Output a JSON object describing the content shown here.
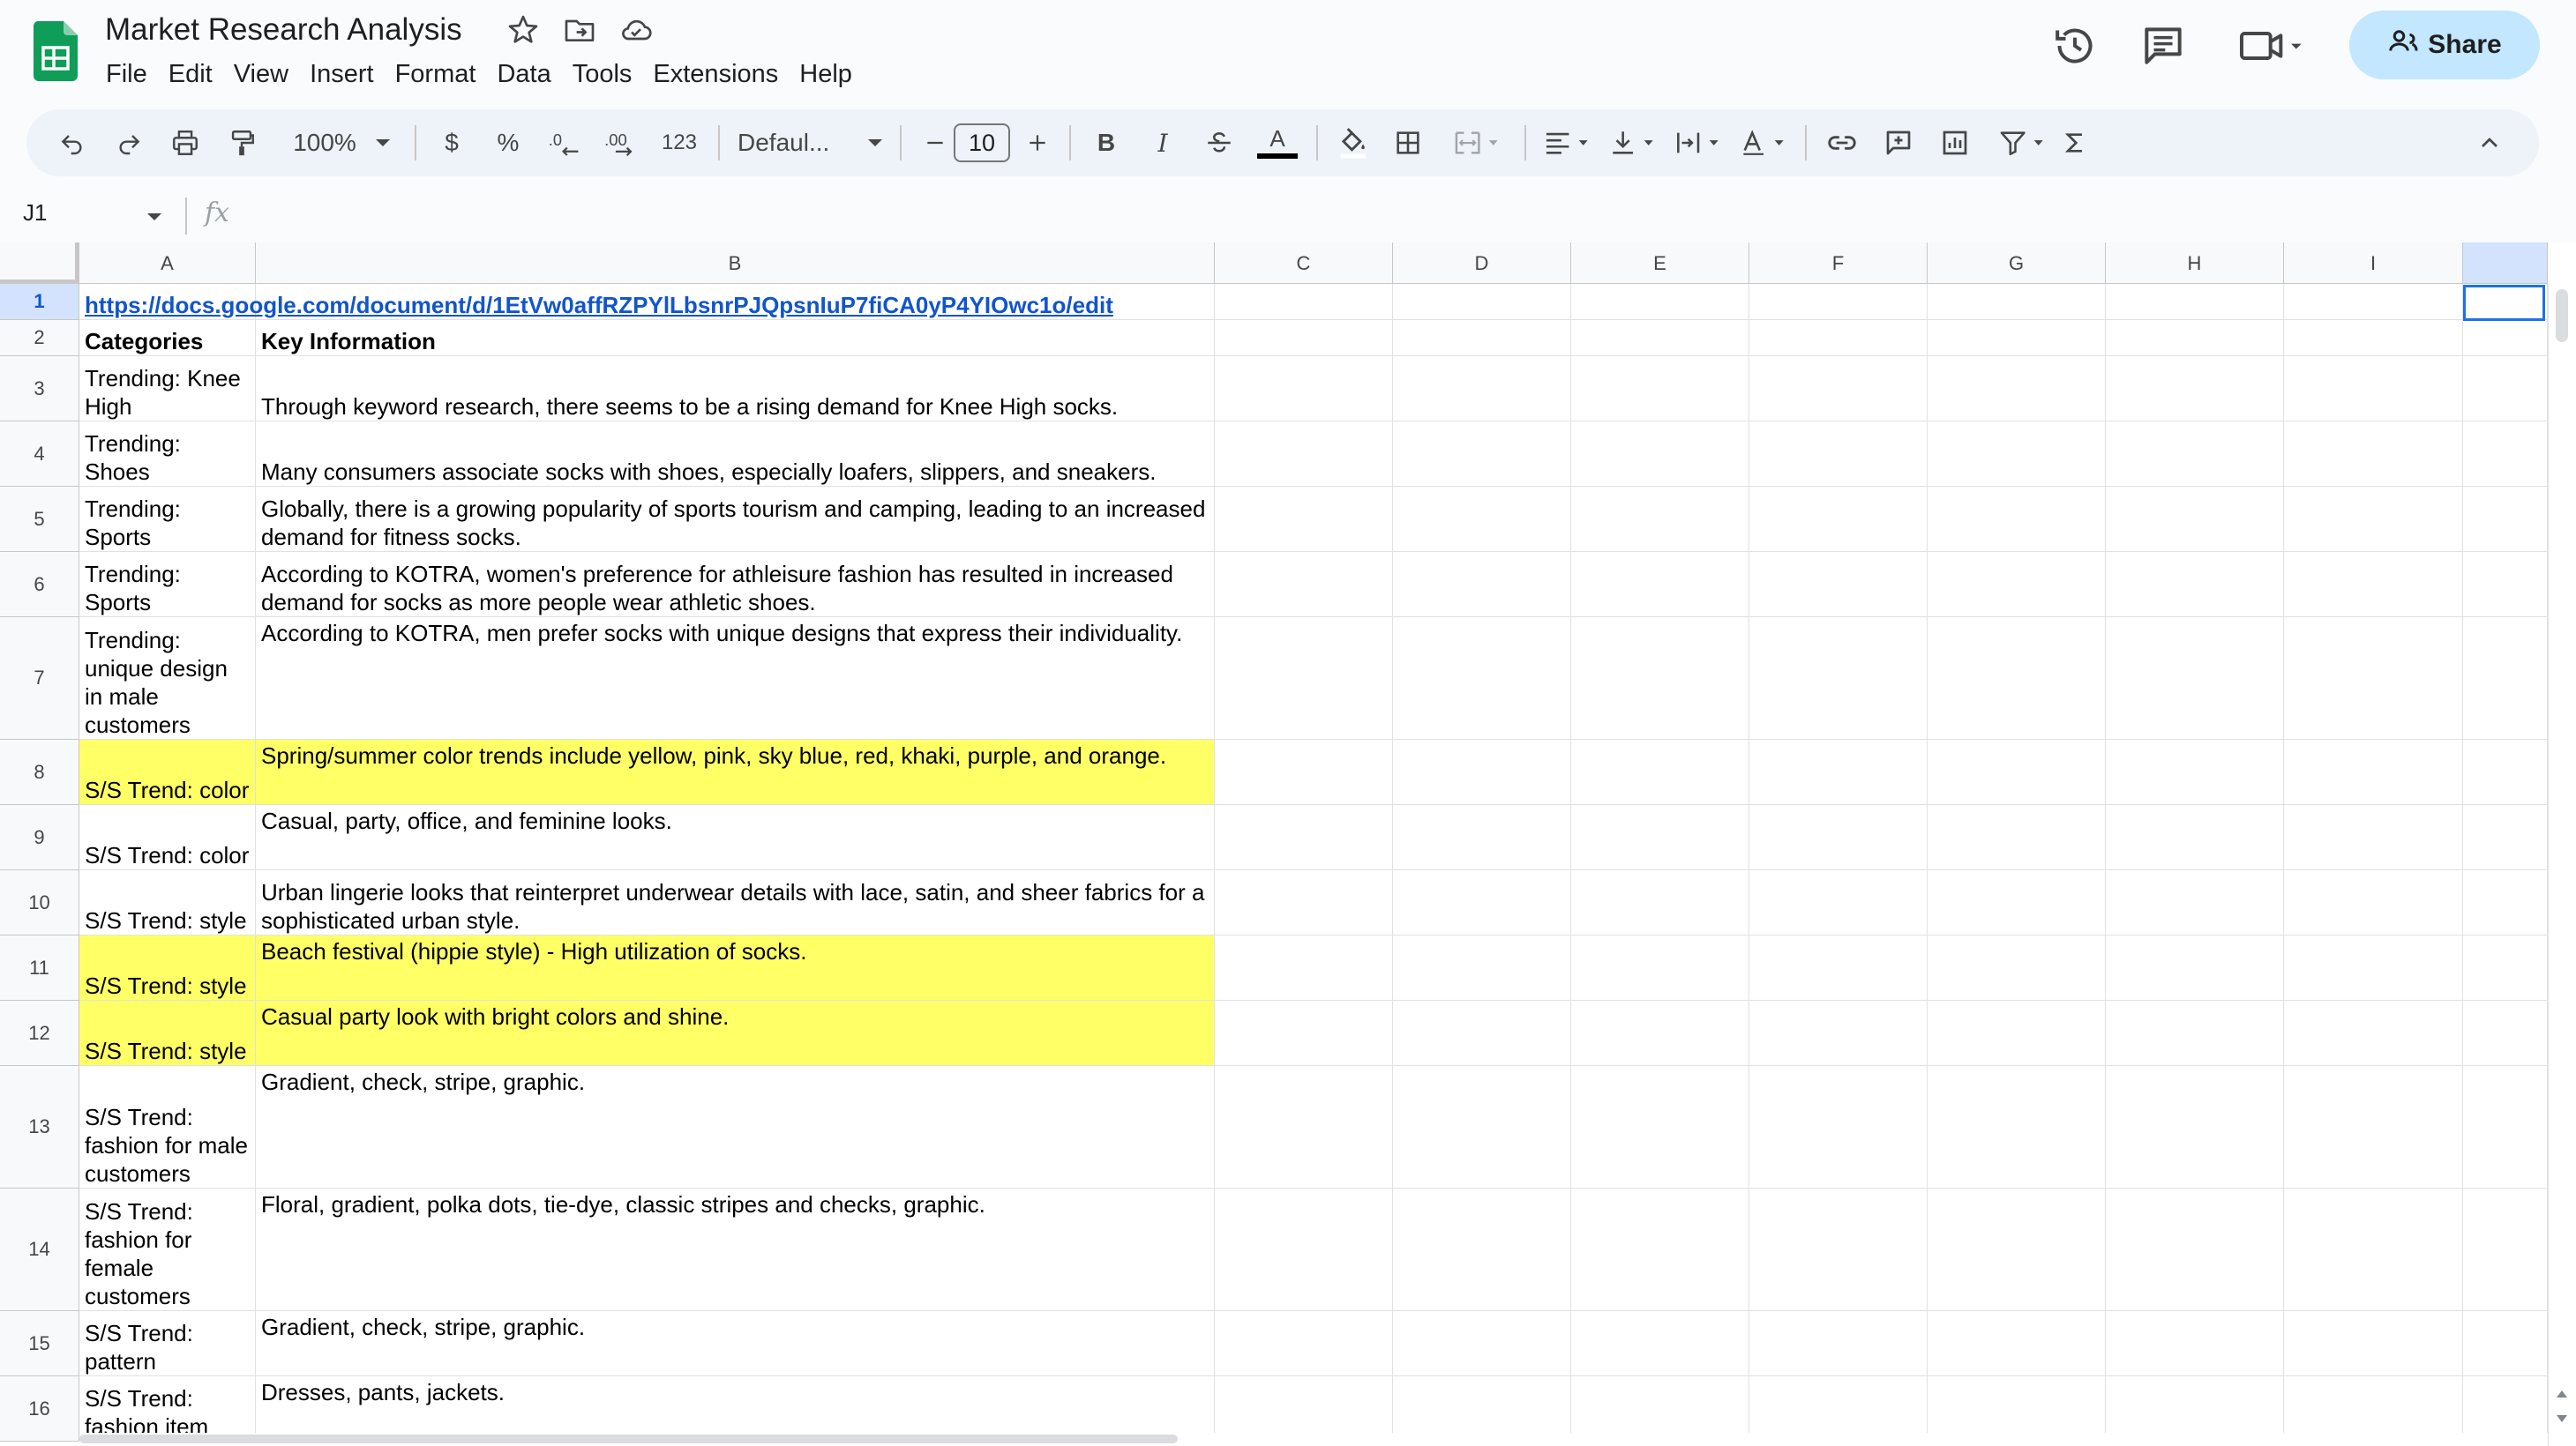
{
  "app": {
    "title": "Market Research Analysis",
    "menu": [
      "File",
      "Edit",
      "View",
      "Insert",
      "Format",
      "Data",
      "Tools",
      "Extensions",
      "Help"
    ],
    "share_label": "Share",
    "accent": "#c2e7ff"
  },
  "toolbar": {
    "zoom": "100%",
    "currency": "$",
    "percent": "%",
    "number_format": "123",
    "font": "Defaul...",
    "font_size": "10",
    "bold": "B",
    "italic": "I",
    "text_color": "A"
  },
  "formula_bar": {
    "cell_ref": "J1",
    "fx": "fx"
  },
  "sheet": {
    "columns": [
      "A",
      "B",
      "C",
      "D",
      "E",
      "F",
      "G",
      "H",
      "I"
    ],
    "highlight_color": "#ffff66",
    "rows": [
      {
        "n": "1",
        "a": "",
        "b": "",
        "link": "https://docs.google.com/document/d/1EtVw0affRZPYlLbsnrPJQpsnIuP7fiCA0yP4YIOwc1o/edit"
      },
      {
        "n": "2",
        "a": "Categories",
        "b": "Key Information"
      },
      {
        "n": "3",
        "a": "Trending: Knee High",
        "b": "Through keyword research, there seems to be a rising demand for Knee High socks."
      },
      {
        "n": "4",
        "a": "Trending: Shoes",
        "b": "Many consumers associate socks with shoes, especially loafers, slippers, and sneakers."
      },
      {
        "n": "5",
        "a": "Trending: Sports",
        "b": "Globally, there is a growing popularity of sports tourism and camping, leading to an increased demand for fitness socks."
      },
      {
        "n": "6",
        "a": "Trending: Sports",
        "b": "According to KOTRA, women's preference for athleisure fashion has resulted in increased demand for socks as more people wear athletic shoes."
      },
      {
        "n": "7",
        "a": "Trending: unique design in male customers",
        "b": "According to KOTRA, men prefer socks with unique designs that express their individuality."
      },
      {
        "n": "8",
        "a": "S/S Trend: color",
        "b": "Spring/summer color trends include yellow, pink, sky blue, red, khaki, purple, and orange."
      },
      {
        "n": "9",
        "a": "S/S Trend: color",
        "b": "Casual, party, office, and feminine looks."
      },
      {
        "n": "10",
        "a": "S/S Trend: style",
        "b": "Urban lingerie looks that reinterpret underwear details with lace, satin, and sheer fabrics for a sophisticated urban style."
      },
      {
        "n": "11",
        "a": "S/S Trend: style",
        "b": "Beach festival (hippie style) - High utilization of socks."
      },
      {
        "n": "12",
        "a": "S/S Trend: style",
        "b": "Casual party look with bright colors and shine."
      },
      {
        "n": "13",
        "a": "S/S Trend: fashion for male customers",
        "b": "Gradient, check, stripe, graphic."
      },
      {
        "n": "14",
        "a": "S/S Trend: fashion for female customers",
        "b": "Floral, gradient, polka dots, tie-dye, classic stripes and checks, graphic."
      },
      {
        "n": "15",
        "a": "S/S Trend: pattern",
        "b": "Gradient, check, stripe, graphic."
      },
      {
        "n": "16",
        "a": "S/S Trend: fashion item",
        "b": "Dresses, pants, jackets."
      }
    ]
  }
}
